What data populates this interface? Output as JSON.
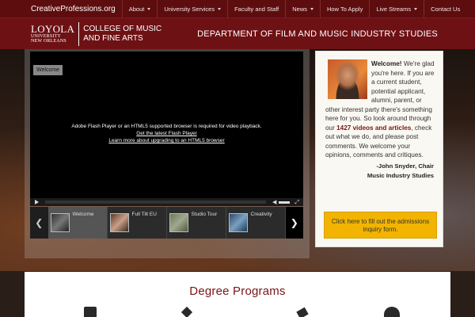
{
  "site": {
    "name": "CreativeProfessions.org"
  },
  "nav": {
    "items": [
      {
        "label": "About",
        "dropdown": true
      },
      {
        "label": "University Services",
        "dropdown": true
      },
      {
        "label": "Faculty and Staff",
        "dropdown": false
      },
      {
        "label": "News",
        "dropdown": true
      },
      {
        "label": "How To Apply",
        "dropdown": false
      },
      {
        "label": "Live Streams",
        "dropdown": true
      },
      {
        "label": "Contact Us",
        "dropdown": false
      }
    ]
  },
  "header": {
    "logo_top": "LOYOLA",
    "logo_middle": "UNIVERSITY",
    "logo_bottom": "NEW ORLEANS",
    "college_line1": "COLLEGE OF MUSIC",
    "college_line2": "AND FINE ARTS",
    "department": "DEPARTMENT OF FILM AND MUSIC INDUSTRY STUDIES"
  },
  "video": {
    "label": "Welcome",
    "message": "Adobe Flash Player or an HTML5 supported browser is required for video playback.",
    "link1": "Get the latest Flash Player",
    "link2": "Learn more about upgrading to an HTML5 browser",
    "thumbnails": [
      {
        "label": "Welcome",
        "active": true
      },
      {
        "label": "Full Tilt EU",
        "active": false
      },
      {
        "label": "Studio Tour",
        "active": false
      },
      {
        "label": "Creativity",
        "active": false
      }
    ]
  },
  "welcome": {
    "heading": "Welcome!",
    "text_before": "We're glad you're here. If you are a current student, potential applicant, alumni, parent, or other interest party there's something here for you. So look around through our",
    "count": "1427 videos and articles",
    "text_after": ", check out what we do, and please post comments. We welcome your opinions, comments and critiques.",
    "signature_line1": "-John Snyder, Chair",
    "signature_line2": "Music Industry Studies",
    "cta": "Click here to fill out the admissions inquiry form."
  },
  "degree": {
    "title": "Degree Programs"
  },
  "colors": {
    "nav_bg": "#5e0d0f",
    "header_bg": "#6e1114",
    "accent": "#7a1414",
    "cta_bg": "#f2b400"
  }
}
